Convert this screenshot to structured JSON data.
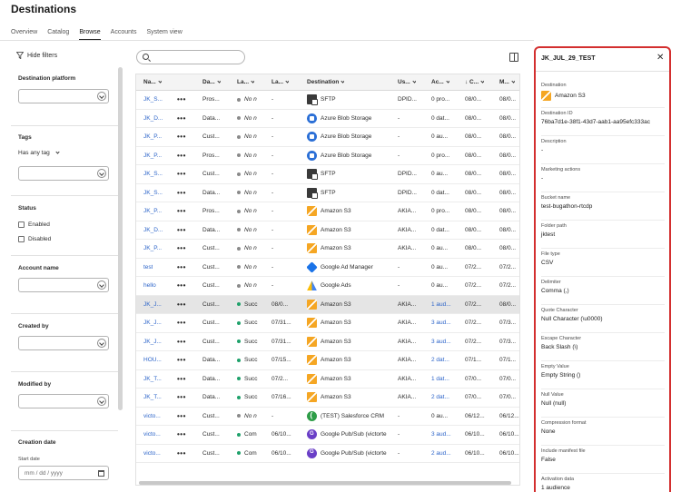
{
  "page": {
    "title": "Destinations"
  },
  "tabs": [
    "Overview",
    "Catalog",
    "Browse",
    "Accounts",
    "System view"
  ],
  "active_tab": "Browse",
  "filters": {
    "hide_label": "Hide filters",
    "destination_platform": "Destination platform",
    "tags": "Tags",
    "tags_mode": "Has any tag",
    "status": "Status",
    "enabled": "Enabled",
    "disabled": "Disabled",
    "account_name": "Account name",
    "created_by": "Created by",
    "modified_by": "Modified by",
    "creation_date": "Creation date",
    "start_date": "Start date",
    "date_placeholder": "mm / dd / yyyy"
  },
  "table": {
    "columns": [
      "Na...",
      "Da...",
      "La...",
      "La...",
      "Destination",
      "Us...",
      "Ac...",
      "↓ C...",
      "M..."
    ],
    "rows": [
      {
        "name": "JK_S...",
        "data": "Pros...",
        "status": "No n",
        "status_color": "grey",
        "last": "-",
        "dest": "SFTP",
        "icon": "sftp",
        "user": "DPID...",
        "act": "0 pro...",
        "act_link": false,
        "created": "08/0...",
        "mod": "08/0...",
        "selected": false
      },
      {
        "name": "JK_D...",
        "data": "Data...",
        "status": "No n",
        "status_color": "grey",
        "last": "-",
        "dest": "Azure Blob Storage",
        "icon": "azure",
        "user": "-",
        "act": "0 dat...",
        "act_link": false,
        "created": "08/0...",
        "mod": "08/0...",
        "selected": false
      },
      {
        "name": "JK_P...",
        "data": "Cust...",
        "status": "No n",
        "status_color": "grey",
        "last": "-",
        "dest": "Azure Blob Storage",
        "icon": "azure",
        "user": "-",
        "act": "0 au...",
        "act_link": false,
        "created": "08/0...",
        "mod": "08/0...",
        "selected": false
      },
      {
        "name": "JK_P...",
        "data": "Pros...",
        "status": "No n",
        "status_color": "grey",
        "last": "-",
        "dest": "Azure Blob Storage",
        "icon": "azure",
        "user": "-",
        "act": "0 pro...",
        "act_link": false,
        "created": "08/0...",
        "mod": "08/0...",
        "selected": false
      },
      {
        "name": "JK_S...",
        "data": "Cust...",
        "status": "No n",
        "status_color": "grey",
        "last": "-",
        "dest": "SFTP",
        "icon": "sftp",
        "user": "DPID...",
        "act": "0 au...",
        "act_link": false,
        "created": "08/0...",
        "mod": "08/0...",
        "selected": false
      },
      {
        "name": "JK_S...",
        "data": "Data...",
        "status": "No n",
        "status_color": "grey",
        "last": "-",
        "dest": "SFTP",
        "icon": "sftp",
        "user": "DPID...",
        "act": "0 dat...",
        "act_link": false,
        "created": "08/0...",
        "mod": "08/0...",
        "selected": false
      },
      {
        "name": "JK_P...",
        "data": "Pros...",
        "status": "No n",
        "status_color": "grey",
        "last": "-",
        "dest": "Amazon S3",
        "icon": "s3",
        "user": "AKIA...",
        "act": "0 pro...",
        "act_link": false,
        "created": "08/0...",
        "mod": "08/0...",
        "selected": false
      },
      {
        "name": "JK_D...",
        "data": "Data...",
        "status": "No n",
        "status_color": "grey",
        "last": "-",
        "dest": "Amazon S3",
        "icon": "s3",
        "user": "AKIA...",
        "act": "0 dat...",
        "act_link": false,
        "created": "08/0...",
        "mod": "08/0...",
        "selected": false
      },
      {
        "name": "JK_P...",
        "data": "Cust...",
        "status": "No n",
        "status_color": "grey",
        "last": "-",
        "dest": "Amazon S3",
        "icon": "s3",
        "user": "AKIA...",
        "act": "0 au...",
        "act_link": false,
        "created": "08/0...",
        "mod": "08/0...",
        "selected": false
      },
      {
        "name": "test",
        "data": "Cust...",
        "status": "No n",
        "status_color": "grey",
        "last": "-",
        "dest": "Google Ad Manager",
        "icon": "gam",
        "user": "-",
        "act": "0 au...",
        "act_link": false,
        "created": "07/2...",
        "mod": "07/2...",
        "selected": false
      },
      {
        "name": "hello",
        "data": "Cust...",
        "status": "No n",
        "status_color": "grey",
        "last": "-",
        "dest": "Google Ads",
        "icon": "gads",
        "user": "-",
        "act": "0 au...",
        "act_link": false,
        "created": "07/2...",
        "mod": "07/2...",
        "selected": false
      },
      {
        "name": "JK_J...",
        "data": "Cust...",
        "status": "Succ",
        "status_color": "green",
        "last": "08/0...",
        "dest": "Amazon S3",
        "icon": "s3",
        "user": "AKIA...",
        "act": "1 aud...",
        "act_link": true,
        "created": "07/2...",
        "mod": "08/0...",
        "selected": true
      },
      {
        "name": "JK_J...",
        "data": "Cust...",
        "status": "Succ",
        "status_color": "green",
        "last": "07/31...",
        "dest": "Amazon S3",
        "icon": "s3",
        "user": "AKIA...",
        "act": "3 aud...",
        "act_link": true,
        "created": "07/2...",
        "mod": "07/3...",
        "selected": false
      },
      {
        "name": "JK_J...",
        "data": "Cust...",
        "status": "Succ",
        "status_color": "green",
        "last": "07/31...",
        "dest": "Amazon S3",
        "icon": "s3",
        "user": "AKIA...",
        "act": "3 aud...",
        "act_link": true,
        "created": "07/2...",
        "mod": "07/3...",
        "selected": false
      },
      {
        "name": "HOU...",
        "data": "Data...",
        "status": "Succ",
        "status_color": "green",
        "last": "07/15...",
        "dest": "Amazon S3",
        "icon": "s3",
        "user": "AKIA...",
        "act": "2 dat...",
        "act_link": true,
        "created": "07/1...",
        "mod": "07/1...",
        "selected": false
      },
      {
        "name": "JK_T...",
        "data": "Data...",
        "status": "Succ",
        "status_color": "green",
        "last": "07/2...",
        "dest": "Amazon S3",
        "icon": "s3",
        "user": "AKIA...",
        "act": "1 dat...",
        "act_link": true,
        "created": "07/0...",
        "mod": "07/0...",
        "selected": false
      },
      {
        "name": "JK_T...",
        "data": "Data...",
        "status": "Succ",
        "status_color": "green",
        "last": "07/16...",
        "dest": "Amazon S3",
        "icon": "s3",
        "user": "AKIA...",
        "act": "2 dat...",
        "act_link": true,
        "created": "07/0...",
        "mod": "07/0...",
        "selected": false
      },
      {
        "name": "victo...",
        "data": "Cust...",
        "status": "No n",
        "status_color": "grey",
        "last": "-",
        "dest": "(TEST) Salesforce CRM",
        "icon": "sf",
        "user": "-",
        "act": "0 au...",
        "act_link": false,
        "created": "06/12...",
        "mod": "06/12...",
        "selected": false
      },
      {
        "name": "victo...",
        "data": "Cust...",
        "status": "Com",
        "status_color": "green",
        "last": "06/10...",
        "dest": "Google Pub/Sub (victorte",
        "icon": "pubsub",
        "user": "-",
        "act": "3 aud...",
        "act_link": true,
        "created": "06/10...",
        "mod": "06/10...",
        "selected": false
      },
      {
        "name": "victo...",
        "data": "Cust...",
        "status": "Com",
        "status_color": "green",
        "last": "06/10...",
        "dest": "Google Pub/Sub (victorte",
        "icon": "pubsub",
        "user": "-",
        "act": "2 aud...",
        "act_link": true,
        "created": "06/10...",
        "mod": "06/10...",
        "selected": false
      }
    ]
  },
  "panel": {
    "title": "JK_JUL_29_TEST",
    "fields": [
      {
        "label": "Destination",
        "value": "Amazon S3",
        "icon": "s3"
      },
      {
        "label": "Destination ID",
        "value": "76ba7d1e-38f1-43d7-aab1-aa95efc333ac"
      },
      {
        "label": "Description",
        "value": "-"
      },
      {
        "label": "Marketing actions",
        "value": "-"
      },
      {
        "label": "Bucket name",
        "value": "test-bugathon-rtcdp"
      },
      {
        "label": "Folder path",
        "value": "jktest"
      },
      {
        "label": "File type",
        "value": "CSV"
      },
      {
        "label": "Delimiter",
        "value": "Comma (,)"
      },
      {
        "label": "Quote Character",
        "value": "Null Character (\\u0000)"
      },
      {
        "label": "Escape Character",
        "value": "Back Slash (\\)"
      },
      {
        "label": "Empty Value",
        "value": "Empty String ()"
      },
      {
        "label": "Null Value",
        "value": "Null (null)"
      },
      {
        "label": "Compression format",
        "value": "None"
      },
      {
        "label": "Include manifest file",
        "value": "False"
      },
      {
        "label": "Activation data",
        "value": "1 audience"
      }
    ]
  }
}
